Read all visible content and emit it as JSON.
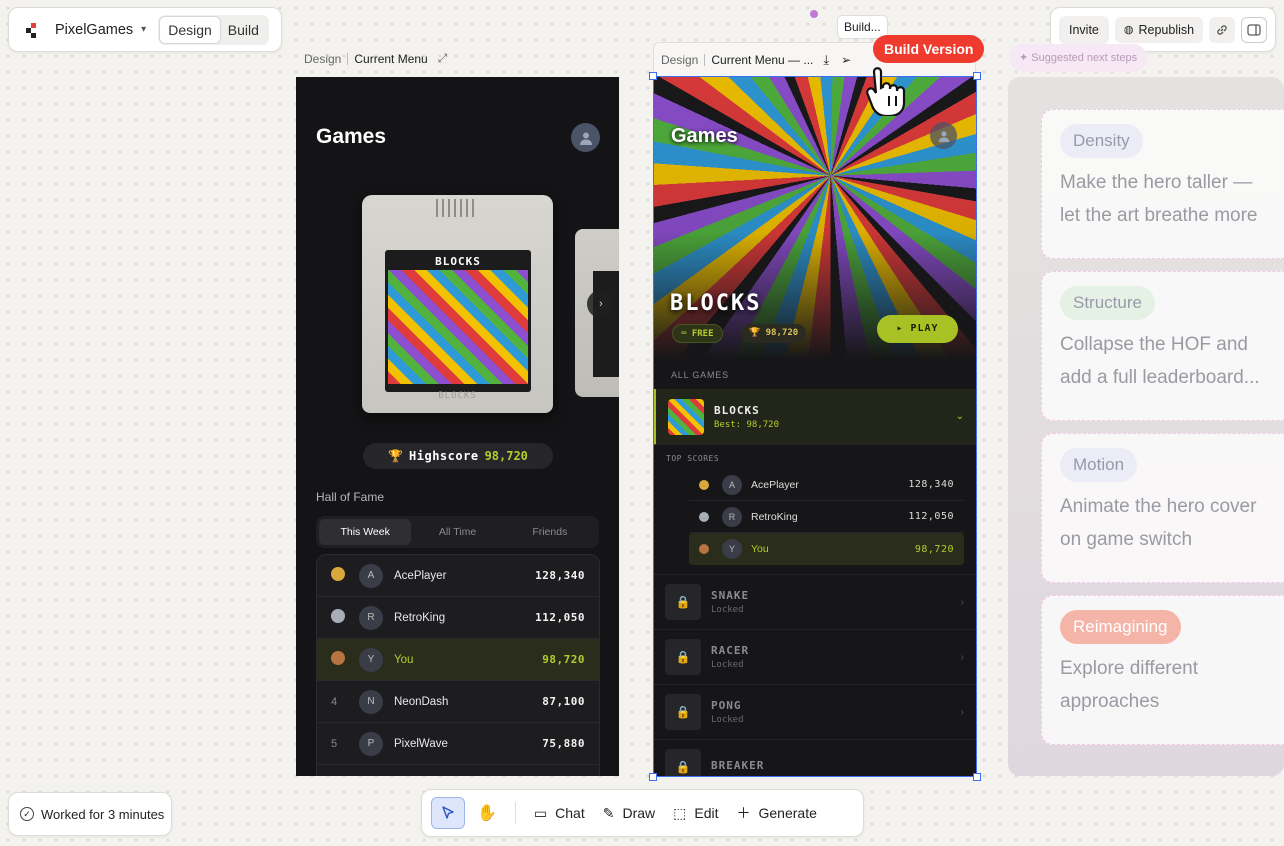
{
  "topbar": {
    "project_name": "PixelGames",
    "modes": [
      "Design",
      "Build"
    ],
    "active_mode": "Design"
  },
  "right_actions": {
    "invite": "Invite",
    "republish": "Republish"
  },
  "frame1": {
    "crumb_section": "Design",
    "crumb_name": "Current Menu"
  },
  "frame2": {
    "crumb_section": "Design",
    "crumb_name": "Current Menu — ...",
    "tooltip": "Build...",
    "badge": "Build Version"
  },
  "phone1": {
    "title": "Games",
    "cartridge_label": "BLOCKS",
    "cartridge_bottom": "BLOCKS",
    "highscore_label": "Highscore",
    "highscore_value": "98,720",
    "hof_title": "Hall of Fame",
    "tabs": [
      "This Week",
      "All Time",
      "Friends"
    ],
    "leaderboard": [
      {
        "rank": "",
        "initial": "A",
        "name": "AcePlayer",
        "score": "128,340",
        "medal": "gold"
      },
      {
        "rank": "",
        "initial": "R",
        "name": "RetroKing",
        "score": "112,050",
        "medal": "silver"
      },
      {
        "rank": "",
        "initial": "Y",
        "name": "You",
        "score": "98,720",
        "medal": "bronze"
      },
      {
        "rank": "4",
        "initial": "N",
        "name": "NeonDash",
        "score": "87,100",
        "medal": ""
      },
      {
        "rank": "5",
        "initial": "P",
        "name": "PixelWave",
        "score": "75,880",
        "medal": ""
      }
    ]
  },
  "phone2": {
    "title": "Games",
    "hero_title": "BLOCKS",
    "free_label": "FREE",
    "hero_score": "98,720",
    "play_label": "▸ PLAY",
    "all_games": "ALL GAMES",
    "selected_game": {
      "name": "BLOCKS",
      "best": "Best: 98,720"
    },
    "top_scores_label": "TOP SCORES",
    "top_scores": [
      {
        "initial": "A",
        "name": "AcePlayer",
        "score": "128,340"
      },
      {
        "initial": "R",
        "name": "RetroKing",
        "score": "112,050"
      },
      {
        "initial": "Y",
        "name": "You",
        "score": "98,720"
      }
    ],
    "locked_games": [
      {
        "name": "SNAKE",
        "status": "Locked"
      },
      {
        "name": "RACER",
        "status": "Locked"
      },
      {
        "name": "PONG",
        "status": "Locked"
      },
      {
        "name": "BREAKER",
        "status": ""
      }
    ]
  },
  "suggestions": {
    "header": "Suggested next steps",
    "cards": [
      {
        "tag": "Density",
        "text_line1": "Make the hero taller —",
        "text_line2": "let the art breathe more",
        "color": "#e9e9f6"
      },
      {
        "tag": "Structure",
        "text_line1": "Collapse the HOF and",
        "text_line2": "add a full leaderboard...",
        "color": "#e6f1e6"
      },
      {
        "tag": "Motion",
        "text_line1": "Animate the hero cover",
        "text_line2": "on game switch",
        "color": "#e9e9f6"
      },
      {
        "tag": "Reimagining",
        "text_line1": "Explore different",
        "text_line2": "approaches",
        "color": "#f4b5a8"
      }
    ]
  },
  "status": {
    "worked": "Worked for 3 minutes"
  },
  "toolbar": {
    "chat": "Chat",
    "draw": "Draw",
    "edit": "Edit",
    "generate": "Generate"
  }
}
